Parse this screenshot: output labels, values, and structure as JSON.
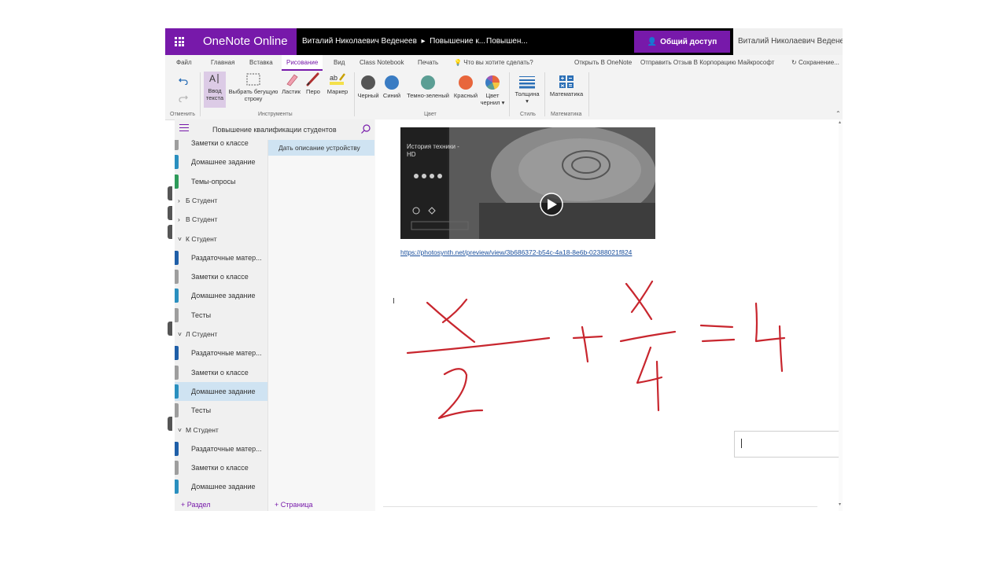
{
  "topbar": {
    "app_name": "OneNote Online",
    "breadcrumb_owner": "Виталий Николаевич Веденеев",
    "breadcrumb_notebook": "Повышение к...",
    "breadcrumb_section": "Повышен...",
    "share_label": "Общий доступ",
    "user_name": "Виталий Николаевич Веденеев"
  },
  "tabs": [
    "Файл",
    "Главная",
    "Вставка",
    "Рисование",
    "Вид",
    "Class Notebook",
    "Печать"
  ],
  "active_tab": "Рисование",
  "tell_me": "Что вы хотите сделать?",
  "tabs_right": {
    "open_in_onenote": "Открыть В OneNote",
    "feedback": "Отправить Отзыв В Корпорацию Майкрософт",
    "saving": "Сохранение..."
  },
  "ribbon": {
    "undo_group": "Отменить",
    "tools_group": "Инструменты",
    "color_group": "Цвет",
    "style_group": "Стиль",
    "math_group": "Математика",
    "text_input_line1": "Ввод",
    "text_input_line2": "текста",
    "select_line1": "Выбрать бегущую",
    "select_line2": "строку",
    "eraser": "Ластик",
    "pen": "Перо",
    "marker": "Маркер",
    "black": "Черный",
    "blue": "Синий",
    "dark_green": "Темно-зеленый",
    "red": "Красный",
    "pen_color_line1": "Цвет",
    "pen_color_line2": "чернил",
    "thickness": "Толщина",
    "math": "Математика"
  },
  "colors": {
    "black": "#555555",
    "blue": "#3a7cc3",
    "dark_green": "#5b9e94",
    "red": "#e8663c",
    "brand": "#7719aa",
    "ink": "#c8262e"
  },
  "nav": {
    "notebook_title": "Повышение квалификации студентов",
    "items": [
      {
        "label": "Заметки о классе",
        "kind": "sec",
        "color": "#9e9e9e"
      },
      {
        "label": "Домашнее задание",
        "kind": "sec",
        "color": "#2a8fbf"
      },
      {
        "label": "Темы-опросы",
        "kind": "sec",
        "color": "#2e9b5a"
      },
      {
        "label": "Б Студент",
        "kind": "grp",
        "expanded": false
      },
      {
        "label": "В Студент",
        "kind": "grp",
        "expanded": false
      },
      {
        "label": "К Студент",
        "kind": "grp",
        "expanded": true
      },
      {
        "label": "Раздаточные матер...",
        "kind": "sec",
        "color": "#1f5fa8"
      },
      {
        "label": "Заметки о классе",
        "kind": "sec",
        "color": "#9e9e9e"
      },
      {
        "label": "Домашнее задание",
        "kind": "sec",
        "color": "#2a8fbf"
      },
      {
        "label": "Тесты",
        "kind": "sec",
        "color": "#9e9e9e"
      },
      {
        "label": "Л Студент",
        "kind": "grp",
        "expanded": true
      },
      {
        "label": "Раздаточные матер...",
        "kind": "sec",
        "color": "#1f5fa8"
      },
      {
        "label": "Заметки о классе",
        "kind": "sec",
        "color": "#9e9e9e"
      },
      {
        "label": "Домашнее задание",
        "kind": "sec",
        "color": "#2a8fbf",
        "selected": true
      },
      {
        "label": "Тесты",
        "kind": "sec",
        "color": "#9e9e9e"
      },
      {
        "label": "М Студент",
        "kind": "grp",
        "expanded": true
      },
      {
        "label": "Раздаточные матер...",
        "kind": "sec",
        "color": "#1f5fa8"
      },
      {
        "label": "Заметки о классе",
        "kind": "sec",
        "color": "#9e9e9e"
      },
      {
        "label": "Домашнее задание",
        "kind": "sec",
        "color": "#2a8fbf"
      }
    ],
    "add_section": "Раздел",
    "add_page": "Страница"
  },
  "pages": [
    "Дать описание устройству"
  ],
  "video": {
    "title_line1": "История техники -",
    "title_line2": "HD"
  },
  "link_url": "https://photosynth.net/preview/view/3b686372-b54c-4a18-8e6b-02388021f824"
}
